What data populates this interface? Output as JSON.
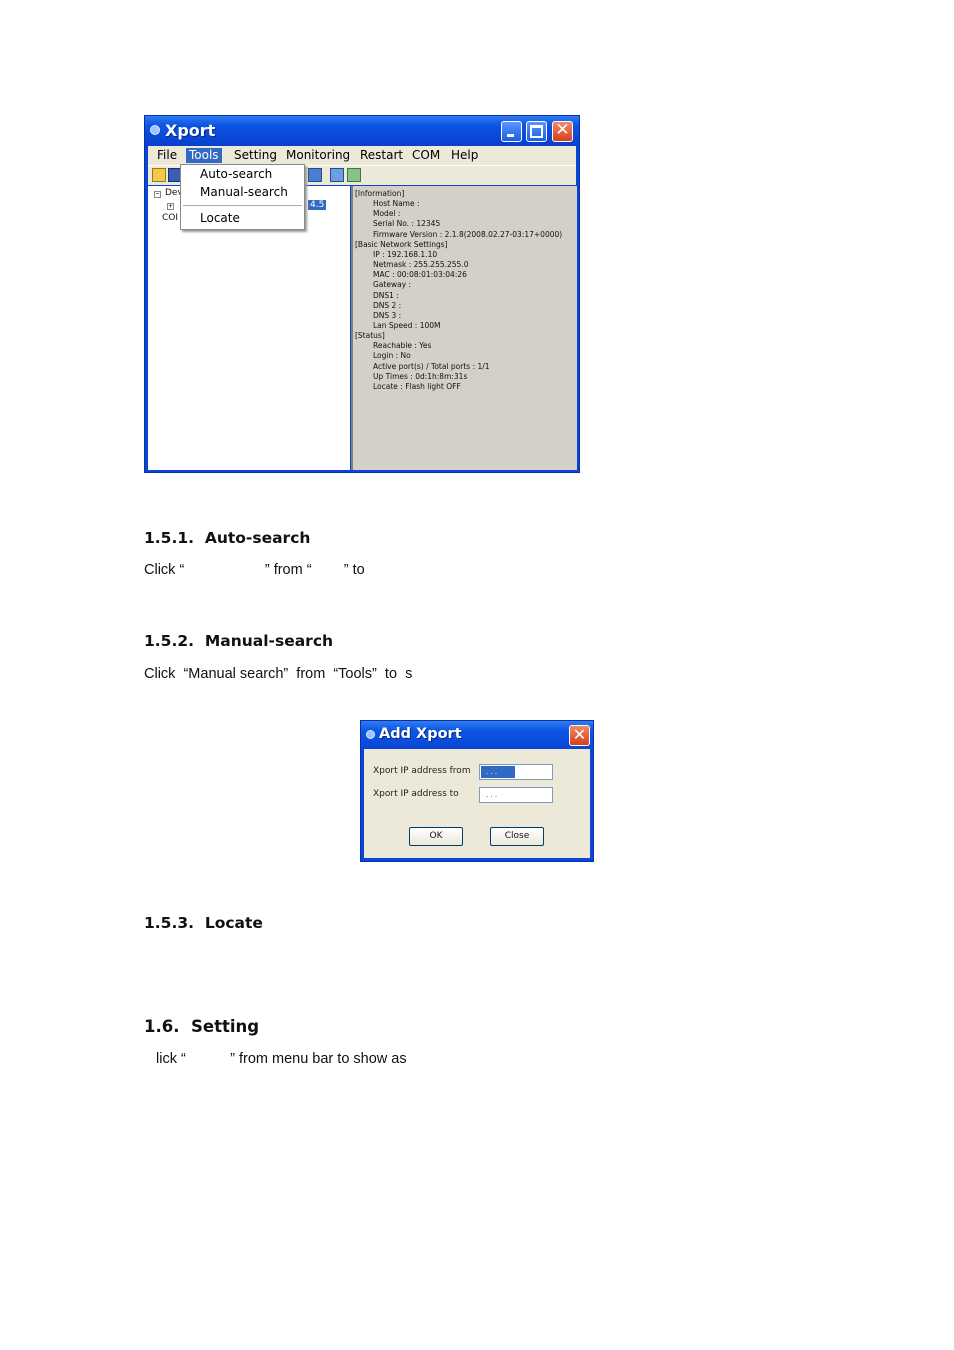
{
  "xport_window": {
    "title": "Xport",
    "menu": [
      "File",
      "Tools",
      "Setting",
      "Monitoring",
      "Restart",
      "COM",
      "Help"
    ],
    "active_menu": "Tools",
    "tools_menu": {
      "items": [
        "Auto-search",
        "Manual-search",
        "Locate"
      ]
    },
    "tree": {
      "root": "Dev",
      "com": "COI",
      "selected_partial": "4.5"
    },
    "info_lines": [
      "[Information]",
      "Host Name :",
      "Model :",
      "Serial No. : 12345",
      "Firmware Version : 2.1.8(2008.02.27-03:17+0000)",
      "[Basic Network Settings]",
      "IP : 192.168.1.10",
      "Netmask : 255.255.255.0",
      "MAC : 00:08:01:03:04:26",
      "Gateway :",
      "DNS1 :",
      "DNS 2 :",
      "DNS 3 :",
      "Lan Speed : 100M",
      "[Status]",
      "Reachable : Yes",
      "Login : No",
      "Active port(s) / Total ports : 1/1",
      "Up Times : 0d:1h:8m:31s",
      "Locate : Flash light OFF"
    ]
  },
  "sections": {
    "s1": {
      "num": "1.5.1.",
      "title": "Auto-search",
      "text": "Click “                    ” from “        ” to"
    },
    "s2": {
      "num": "1.5.2.",
      "title": "Manual-search",
      "text": "Click  “Manual search”  from  “Tools”  to  s"
    },
    "s3": {
      "num": "1.5.3.",
      "title": "Locate"
    },
    "s4": {
      "num": "1.6.",
      "title": "Setting",
      "text": "lick “           ” from menu bar to show as"
    }
  },
  "add_dialog": {
    "title": "Add Xport",
    "from_label": "Xport IP address from",
    "to_label": "Xport IP address to",
    "from_value": ". . .",
    "to_value": ". . .",
    "ok_label": "OK",
    "close_label": "Close"
  }
}
